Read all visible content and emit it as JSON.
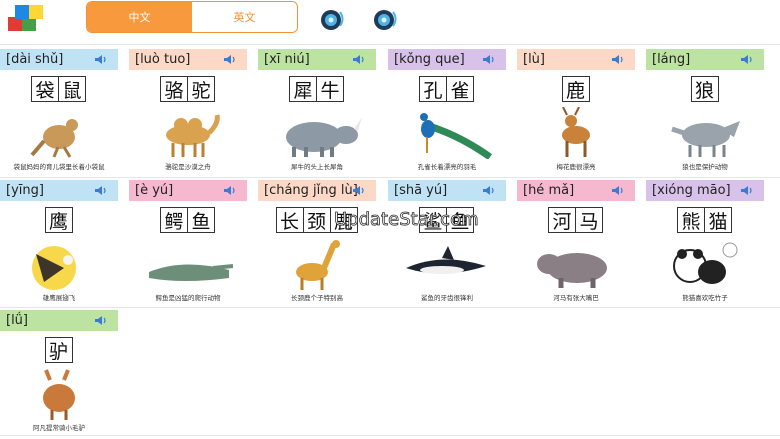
{
  "header": {
    "tabs": [
      {
        "label": "中文",
        "active": true
      },
      {
        "label": "英文",
        "active": false
      }
    ]
  },
  "colors": {
    "accent": "#f8993d",
    "bar_blue": "#bfe3f5",
    "bar_peach": "#fbd9c6",
    "bar_green": "#bde3a3",
    "bar_purple": "#d9c2ea",
    "bar_pink": "#f6b8cf"
  },
  "cards": [
    {
      "pinyin": "[dài shǔ]",
      "hanzi": [
        "袋",
        "鼠"
      ],
      "caption": "袋鼠妈妈的育儿袋里长着小袋鼠",
      "icon": "kangaroo-image",
      "bar": "bar_blue"
    },
    {
      "pinyin": "[luò tuo]",
      "hanzi": [
        "骆",
        "驼"
      ],
      "caption": "骆驼是沙漠之舟",
      "icon": "camel-image",
      "bar": "bar_peach"
    },
    {
      "pinyin": "[xī niú]",
      "hanzi": [
        "犀",
        "牛"
      ],
      "caption": "犀牛的头上长犀角",
      "icon": "rhino-image",
      "bar": "bar_green"
    },
    {
      "pinyin": "[kǒng que]",
      "hanzi": [
        "孔",
        "雀"
      ],
      "caption": "孔雀长着漂亮的羽毛",
      "icon": "peacock-image",
      "bar": "bar_purple"
    },
    {
      "pinyin": "[lù]",
      "hanzi": [
        "鹿"
      ],
      "caption": "梅花鹿很漂亮",
      "icon": "deer-image",
      "bar": "bar_peach"
    },
    {
      "pinyin": "[láng]",
      "hanzi": [
        "狼"
      ],
      "caption": "狼也是保护动物",
      "icon": "wolf-image",
      "bar": "bar_green"
    },
    {
      "pinyin": "[yīng]",
      "hanzi": [
        "鹰"
      ],
      "caption": "雄鹰展翅飞",
      "icon": "eagle-image",
      "bar": "bar_blue"
    },
    {
      "pinyin": "[è yú]",
      "hanzi": [
        "鳄",
        "鱼"
      ],
      "caption": "鳄鱼是凶猛的爬行动物",
      "icon": "crocodile-image",
      "bar": "bar_pink"
    },
    {
      "pinyin": "[cháng jǐng lù]",
      "hanzi": [
        "长",
        "颈",
        "鹿"
      ],
      "caption": "长颈鹿个子特别高",
      "icon": "giraffe-image",
      "bar": "bar_peach"
    },
    {
      "pinyin": "[shā yú]",
      "hanzi": [
        "鲨",
        "鱼"
      ],
      "caption": "鲨鱼的牙齿很锋利",
      "icon": "shark-image",
      "bar": "bar_blue"
    },
    {
      "pinyin": "[hé mǎ]",
      "hanzi": [
        "河",
        "马"
      ],
      "caption": "河马有张大嘴巴",
      "icon": "hippo-image",
      "bar": "bar_pink"
    },
    {
      "pinyin": "[xióng māo]",
      "hanzi": [
        "熊",
        "猫"
      ],
      "caption": "熊猫喜欢吃竹子",
      "icon": "panda-image",
      "bar": "bar_purple"
    },
    {
      "pinyin": "[lǘ]",
      "hanzi": [
        "驴"
      ],
      "caption": "阿凡提常骑小毛驴",
      "icon": "donkey-image",
      "bar": "bar_green"
    }
  ],
  "watermark": "UpdateStar.com"
}
